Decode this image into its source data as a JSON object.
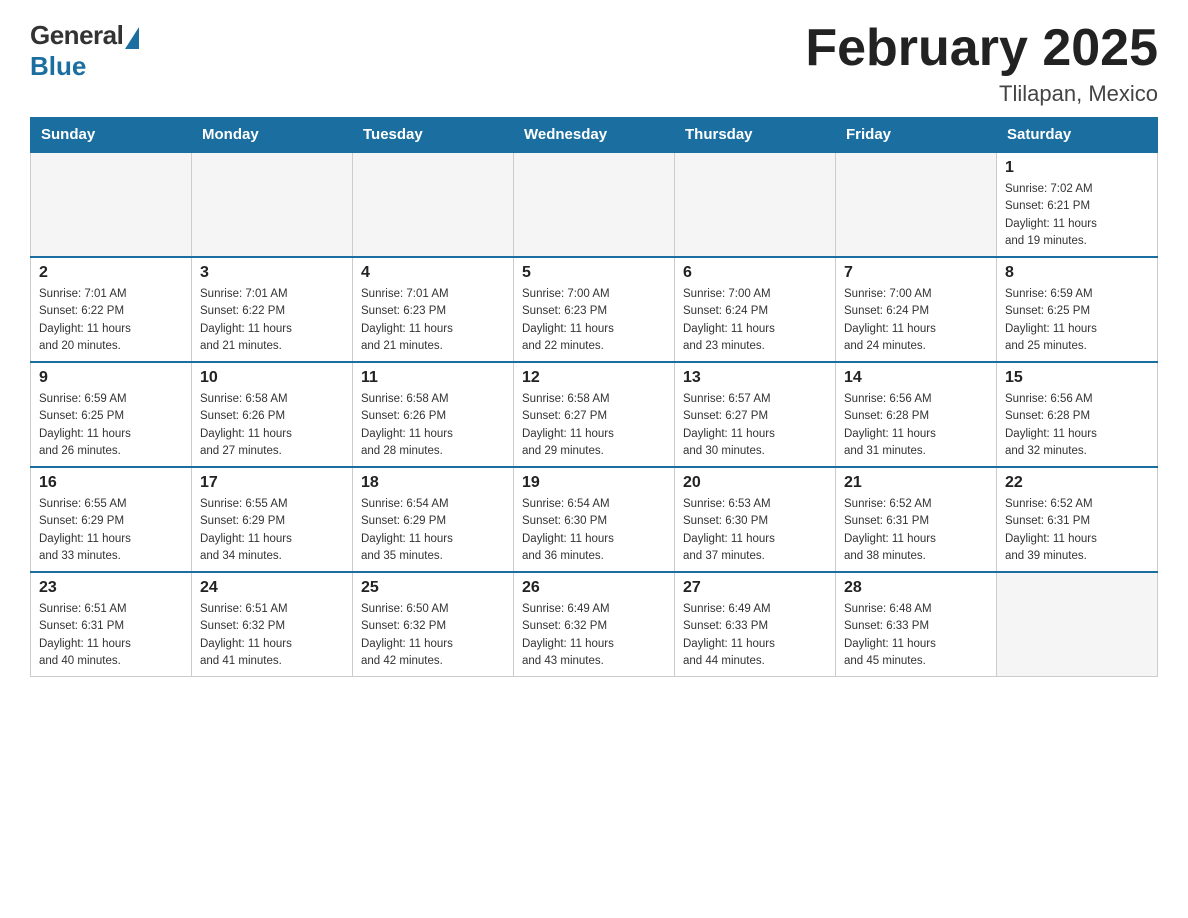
{
  "logo": {
    "general": "General",
    "blue": "Blue"
  },
  "title": "February 2025",
  "location": "Tlilapan, Mexico",
  "weekdays": [
    "Sunday",
    "Monday",
    "Tuesday",
    "Wednesday",
    "Thursday",
    "Friday",
    "Saturday"
  ],
  "weeks": [
    [
      {
        "day": "",
        "info": ""
      },
      {
        "day": "",
        "info": ""
      },
      {
        "day": "",
        "info": ""
      },
      {
        "day": "",
        "info": ""
      },
      {
        "day": "",
        "info": ""
      },
      {
        "day": "",
        "info": ""
      },
      {
        "day": "1",
        "info": "Sunrise: 7:02 AM\nSunset: 6:21 PM\nDaylight: 11 hours\nand 19 minutes."
      }
    ],
    [
      {
        "day": "2",
        "info": "Sunrise: 7:01 AM\nSunset: 6:22 PM\nDaylight: 11 hours\nand 20 minutes."
      },
      {
        "day": "3",
        "info": "Sunrise: 7:01 AM\nSunset: 6:22 PM\nDaylight: 11 hours\nand 21 minutes."
      },
      {
        "day": "4",
        "info": "Sunrise: 7:01 AM\nSunset: 6:23 PM\nDaylight: 11 hours\nand 21 minutes."
      },
      {
        "day": "5",
        "info": "Sunrise: 7:00 AM\nSunset: 6:23 PM\nDaylight: 11 hours\nand 22 minutes."
      },
      {
        "day": "6",
        "info": "Sunrise: 7:00 AM\nSunset: 6:24 PM\nDaylight: 11 hours\nand 23 minutes."
      },
      {
        "day": "7",
        "info": "Sunrise: 7:00 AM\nSunset: 6:24 PM\nDaylight: 11 hours\nand 24 minutes."
      },
      {
        "day": "8",
        "info": "Sunrise: 6:59 AM\nSunset: 6:25 PM\nDaylight: 11 hours\nand 25 minutes."
      }
    ],
    [
      {
        "day": "9",
        "info": "Sunrise: 6:59 AM\nSunset: 6:25 PM\nDaylight: 11 hours\nand 26 minutes."
      },
      {
        "day": "10",
        "info": "Sunrise: 6:58 AM\nSunset: 6:26 PM\nDaylight: 11 hours\nand 27 minutes."
      },
      {
        "day": "11",
        "info": "Sunrise: 6:58 AM\nSunset: 6:26 PM\nDaylight: 11 hours\nand 28 minutes."
      },
      {
        "day": "12",
        "info": "Sunrise: 6:58 AM\nSunset: 6:27 PM\nDaylight: 11 hours\nand 29 minutes."
      },
      {
        "day": "13",
        "info": "Sunrise: 6:57 AM\nSunset: 6:27 PM\nDaylight: 11 hours\nand 30 minutes."
      },
      {
        "day": "14",
        "info": "Sunrise: 6:56 AM\nSunset: 6:28 PM\nDaylight: 11 hours\nand 31 minutes."
      },
      {
        "day": "15",
        "info": "Sunrise: 6:56 AM\nSunset: 6:28 PM\nDaylight: 11 hours\nand 32 minutes."
      }
    ],
    [
      {
        "day": "16",
        "info": "Sunrise: 6:55 AM\nSunset: 6:29 PM\nDaylight: 11 hours\nand 33 minutes."
      },
      {
        "day": "17",
        "info": "Sunrise: 6:55 AM\nSunset: 6:29 PM\nDaylight: 11 hours\nand 34 minutes."
      },
      {
        "day": "18",
        "info": "Sunrise: 6:54 AM\nSunset: 6:29 PM\nDaylight: 11 hours\nand 35 minutes."
      },
      {
        "day": "19",
        "info": "Sunrise: 6:54 AM\nSunset: 6:30 PM\nDaylight: 11 hours\nand 36 minutes."
      },
      {
        "day": "20",
        "info": "Sunrise: 6:53 AM\nSunset: 6:30 PM\nDaylight: 11 hours\nand 37 minutes."
      },
      {
        "day": "21",
        "info": "Sunrise: 6:52 AM\nSunset: 6:31 PM\nDaylight: 11 hours\nand 38 minutes."
      },
      {
        "day": "22",
        "info": "Sunrise: 6:52 AM\nSunset: 6:31 PM\nDaylight: 11 hours\nand 39 minutes."
      }
    ],
    [
      {
        "day": "23",
        "info": "Sunrise: 6:51 AM\nSunset: 6:31 PM\nDaylight: 11 hours\nand 40 minutes."
      },
      {
        "day": "24",
        "info": "Sunrise: 6:51 AM\nSunset: 6:32 PM\nDaylight: 11 hours\nand 41 minutes."
      },
      {
        "day": "25",
        "info": "Sunrise: 6:50 AM\nSunset: 6:32 PM\nDaylight: 11 hours\nand 42 minutes."
      },
      {
        "day": "26",
        "info": "Sunrise: 6:49 AM\nSunset: 6:32 PM\nDaylight: 11 hours\nand 43 minutes."
      },
      {
        "day": "27",
        "info": "Sunrise: 6:49 AM\nSunset: 6:33 PM\nDaylight: 11 hours\nand 44 minutes."
      },
      {
        "day": "28",
        "info": "Sunrise: 6:48 AM\nSunset: 6:33 PM\nDaylight: 11 hours\nand 45 minutes."
      },
      {
        "day": "",
        "info": ""
      }
    ]
  ]
}
